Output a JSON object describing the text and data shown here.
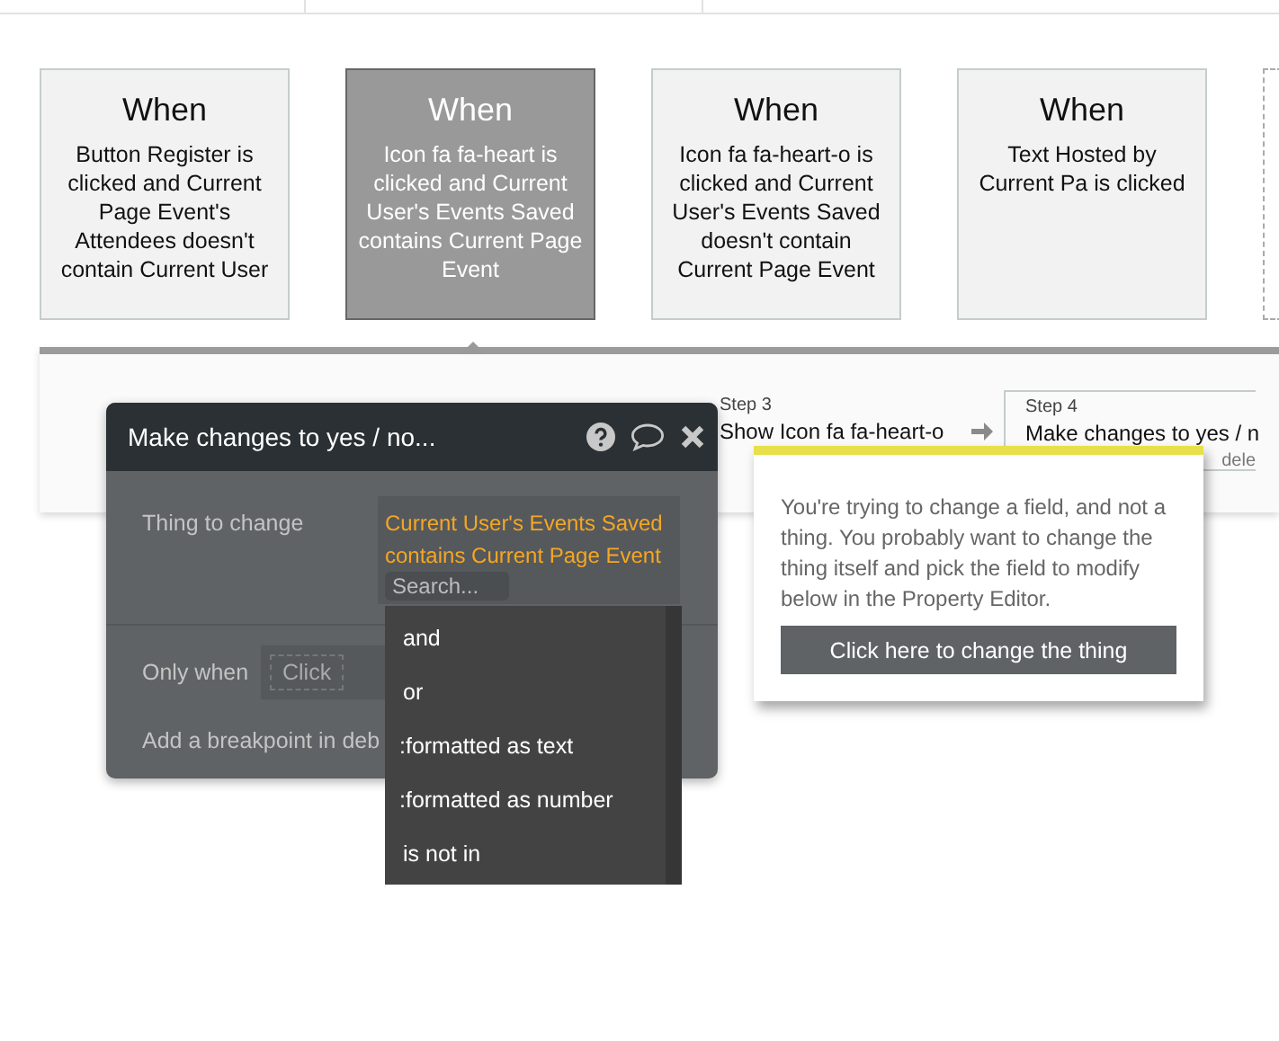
{
  "events": [
    {
      "heading": "When",
      "description": "Button Register is clicked and Current Page Event's Attendees doesn't contain Current User",
      "selected": false
    },
    {
      "heading": "When",
      "description": "Icon fa fa-heart is clicked and Current User's Events Saved contains Current Page Event",
      "selected": true
    },
    {
      "heading": "When",
      "description": "Icon fa fa-heart-o is clicked and Current User's Events Saved doesn't contain Current Page Event",
      "selected": false
    },
    {
      "heading": "When",
      "description": "Text Hosted by Current Pa is clicked",
      "selected": false
    }
  ],
  "steps": [
    {
      "label": "Step 3",
      "title": "Show Icon fa fa-heart-o",
      "selected": false
    },
    {
      "label": "Step 4",
      "title": "Make changes to yes / n",
      "action": "dele",
      "selected": true
    }
  ],
  "editor": {
    "title": "Make changes to yes / no...",
    "thing_to_change": {
      "label": "Thing to change",
      "value": "Current User's Events Saved contains Current Page Event",
      "placeholder": "Search..."
    },
    "only_when": {
      "label": "Only when",
      "placeholder": "Click"
    },
    "breakpoint_label": "Add a breakpoint in deb"
  },
  "dropdown": {
    "options": [
      "and",
      "or",
      ":formatted as text",
      ":formatted as number",
      "is not in"
    ]
  },
  "tooltip": {
    "message": "You're trying to change a field, and not a thing. You probably want to change the thing itself and pick the field to modify below in the Property Editor.",
    "button": "Click here to change the thing"
  }
}
